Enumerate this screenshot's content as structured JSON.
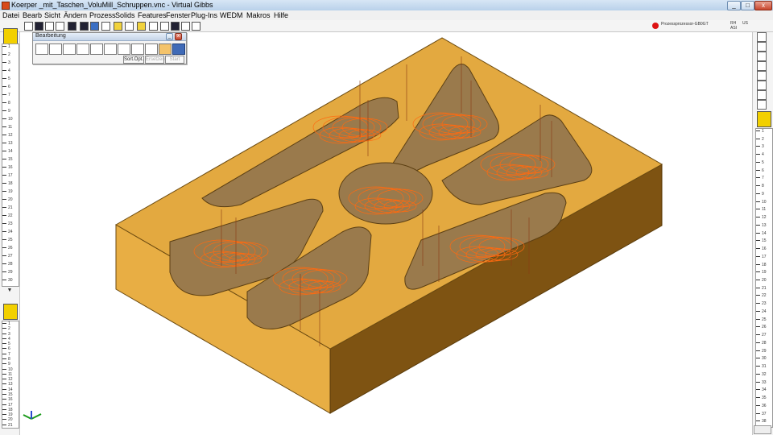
{
  "window": {
    "title": "Koerper _mit_Taschen_VoluMill_Schruppen.vnc - Virtual Gibbs",
    "app_icon": "virtual-gibbs-icon",
    "controls": [
      "minimize-icon",
      "maximize-icon",
      "close-icon"
    ]
  },
  "menu": [
    "Datei",
    "Bearb",
    "Sicht",
    "Ändern",
    "Prozess",
    "Solids",
    "Features",
    "Fenster",
    "Plug-Ins",
    "WEDM",
    "Makros",
    "Hilfe"
  ],
  "status": {
    "processor_text": "Prozessprozessor-GB0GT",
    "units_top": "RH",
    "units_bottom": "ASI",
    "units_right": "US"
  },
  "panel": {
    "title": "Bearbeitung",
    "buttons": [
      "sort-opt-button",
      "ersetzen-button",
      "start-button"
    ],
    "sort_label": "Sort.Opt.",
    "replace_label": "Ersetzen",
    "start_label": "Start"
  },
  "ruler_left_top": [
    "1",
    "2",
    "3",
    "4",
    "5",
    "6",
    "7",
    "8",
    "9",
    "10",
    "11",
    "12",
    "13",
    "14",
    "15",
    "16",
    "17",
    "18",
    "19",
    "20",
    "21",
    "22",
    "23",
    "24",
    "25",
    "26",
    "27",
    "28",
    "29",
    "30"
  ],
  "ruler_left_bottom": [
    "1",
    "2",
    "3",
    "4",
    "5",
    "6",
    "7",
    "8",
    "9",
    "10",
    "11",
    "12",
    "13",
    "14",
    "15",
    "16",
    "17",
    "18",
    "19",
    "20",
    "21"
  ],
  "ruler_right": [
    "1",
    "2",
    "3",
    "4",
    "5",
    "6",
    "7",
    "8",
    "9",
    "10",
    "11",
    "12",
    "13",
    "14",
    "15",
    "16",
    "17",
    "18",
    "19",
    "20",
    "21",
    "22",
    "23",
    "24",
    "25",
    "26",
    "27",
    "28",
    "29",
    "30",
    "31",
    "32",
    "33",
    "34",
    "35",
    "36",
    "37",
    "38"
  ],
  "colors": {
    "block_top": "#e3a940",
    "block_left": "#e8ae44",
    "block_front": "#b97e25",
    "block_right": "#8a5a14",
    "pocket": "#9a7a4c",
    "toolpath": "#ff6a10"
  }
}
